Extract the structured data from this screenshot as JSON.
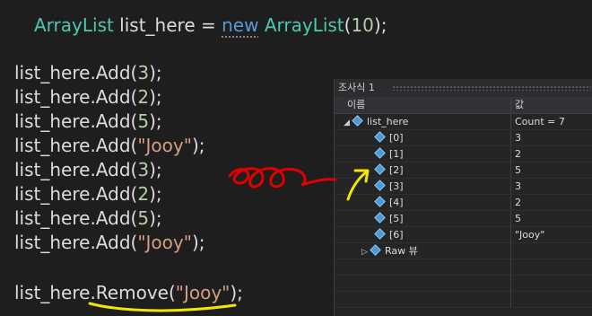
{
  "code": {
    "decl": {
      "type": "ArrayList",
      "var": " list_here = ",
      "kw": "new",
      "ctor": "ArrayList",
      "open": "(",
      "num": "10",
      "close": ");"
    },
    "adds": [
      {
        "prefix": "list_here.Add(",
        "arg": "3",
        "kind": "num",
        "suffix": ");"
      },
      {
        "prefix": "list_here.Add(",
        "arg": "2",
        "kind": "num",
        "suffix": ");"
      },
      {
        "prefix": "list_here.Add(",
        "arg": "5",
        "kind": "num",
        "suffix": ");"
      },
      {
        "prefix": "list_here.Add(",
        "arg": "\"Jooy\"",
        "kind": "str",
        "suffix": ");"
      },
      {
        "prefix": "list_here.Add(",
        "arg": "3",
        "kind": "num",
        "suffix": ");"
      },
      {
        "prefix": "list_here.Add(",
        "arg": "2",
        "kind": "num",
        "suffix": ");"
      },
      {
        "prefix": "list_here.Add(",
        "arg": "5",
        "kind": "num",
        "suffix": ");"
      },
      {
        "prefix": "list_here.Add(",
        "arg": "\"Jooy\"",
        "kind": "str",
        "suffix": ");"
      }
    ],
    "remove": {
      "prefix": "list_here.Remove(",
      "arg": "\"Jooy\"",
      "suffix": ");"
    }
  },
  "watch": {
    "title": "조사식 1",
    "col_name": "이름",
    "col_value": "값",
    "root": {
      "name": "list_here",
      "value": "Count = 7"
    },
    "items": [
      {
        "name": "[0]",
        "value": "3"
      },
      {
        "name": "[1]",
        "value": "2"
      },
      {
        "name": "[2]",
        "value": "5"
      },
      {
        "name": "[3]",
        "value": "3"
      },
      {
        "name": "[4]",
        "value": "2"
      },
      {
        "name": "[5]",
        "value": "5"
      },
      {
        "name": "[6]",
        "value": "\"Jooy\""
      }
    ],
    "raw": {
      "name": "Raw 뷰"
    }
  },
  "colors": {
    "background": "#1e1e1e",
    "type": "#4ec9b0",
    "keyword": "#569cd6",
    "number": "#b5cea8",
    "string": "#d69d85",
    "annotation_red": "#e00000",
    "annotation_yellow": "#f5e600"
  }
}
